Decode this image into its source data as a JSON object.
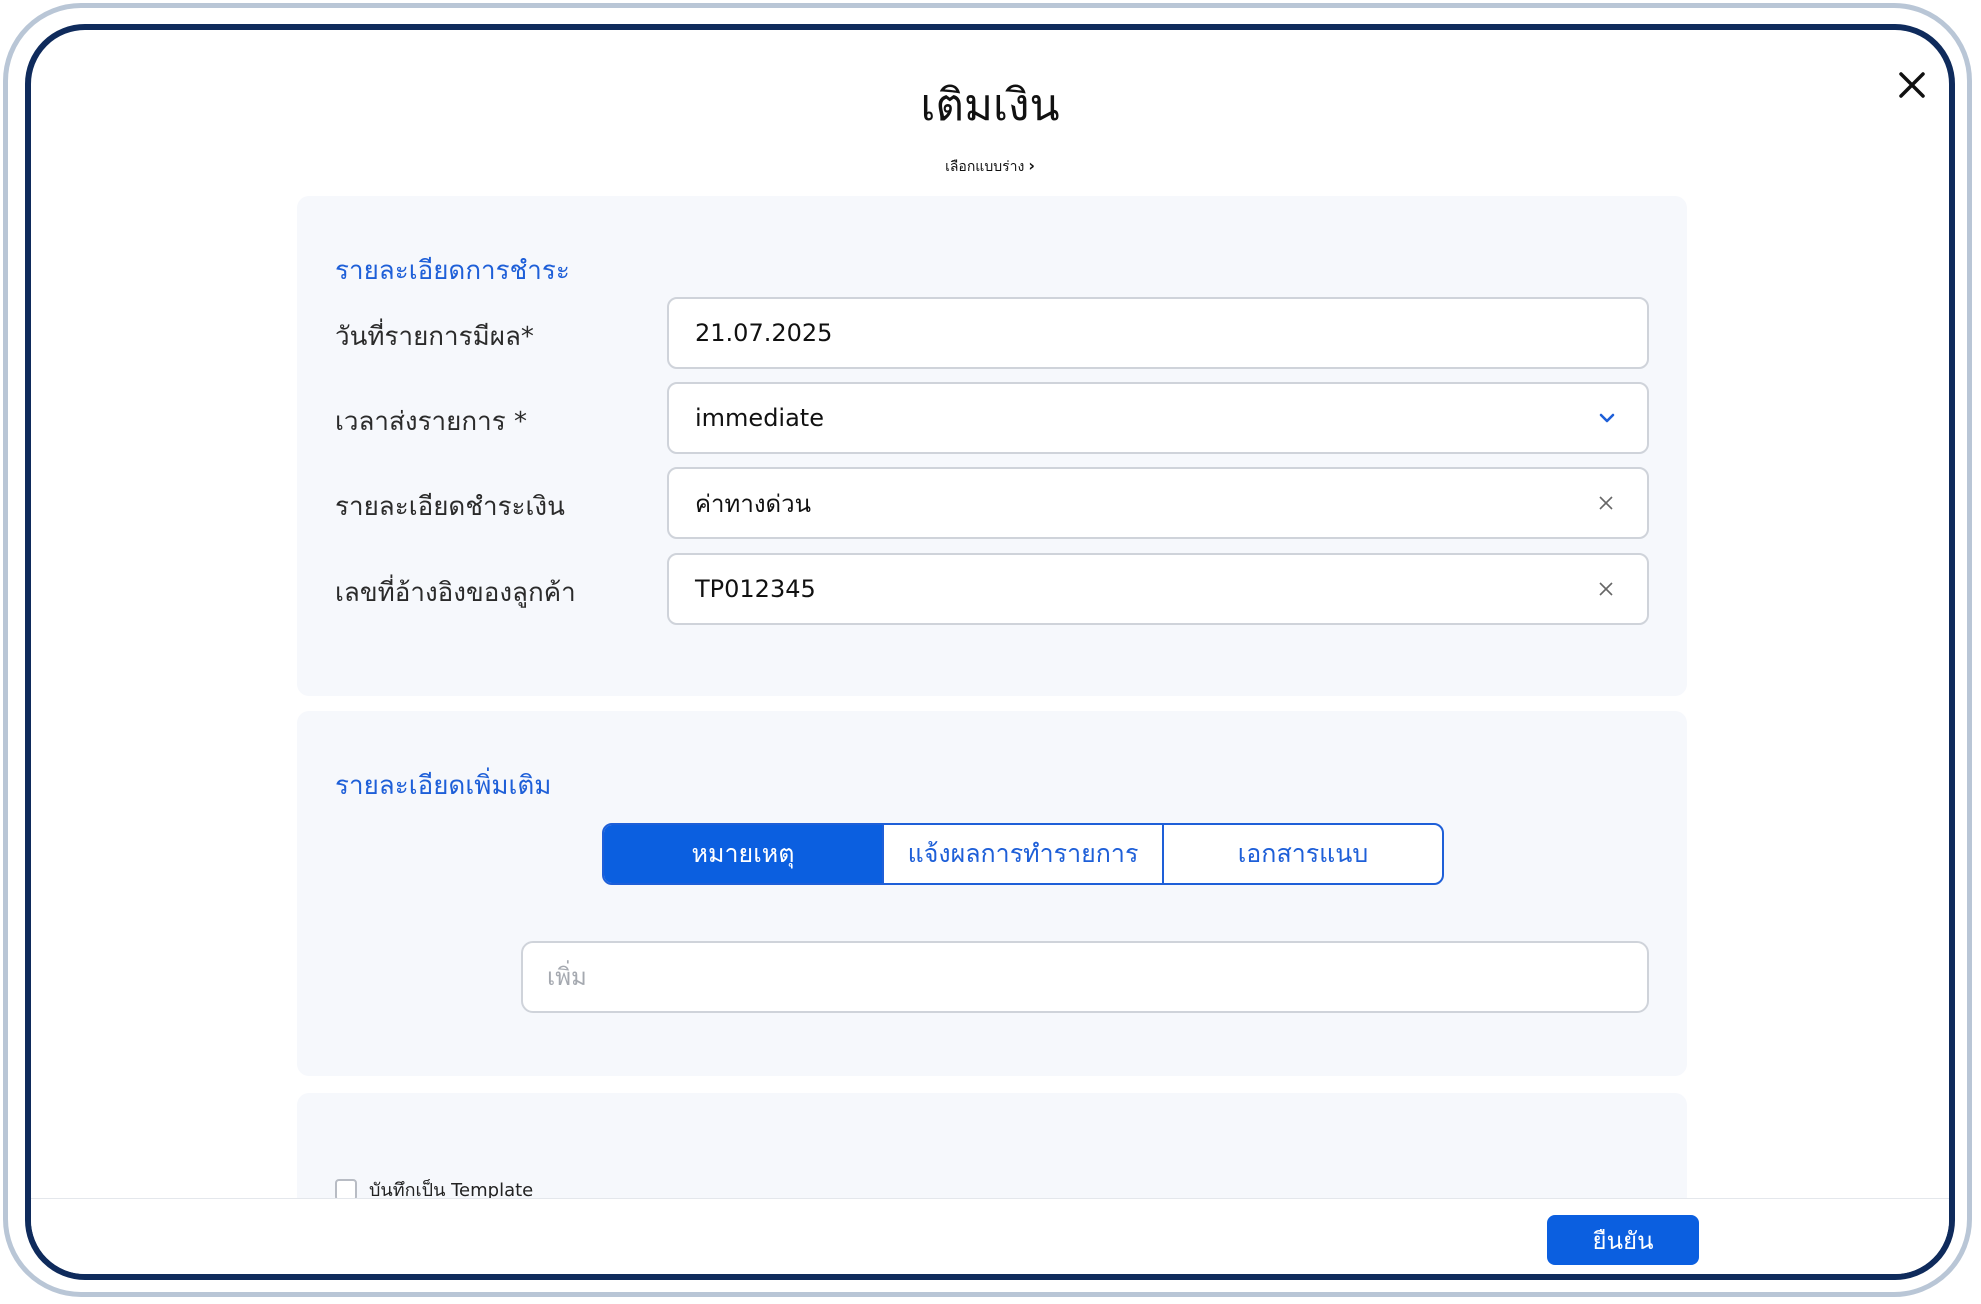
{
  "dialog": {
    "title": "เติมเงิน",
    "close_icon": "close-icon",
    "draft_link": "เลือกแบบร่าง",
    "draft_chevron_icon": "chevron-right-icon"
  },
  "payment_details": {
    "section_title": "รายละเอียดการชำระ",
    "effective_date": {
      "label": "วันที่รายการมีผล*",
      "value": "21.07.2025"
    },
    "send_time": {
      "label": "เวลาส่งรายการ *",
      "value": "immediate",
      "icon": "chevron-down-icon"
    },
    "payment_description": {
      "label": "รายละเอียดชำระเงิน",
      "value": "ค่าทางด่วน",
      "icon": "clear-icon"
    },
    "customer_reference": {
      "label": "เลขที่อ้างอิงของลูกค้า",
      "value": "TP012345",
      "icon": "clear-icon"
    }
  },
  "additional_details": {
    "section_title": "รายละเอียดเพิ่มเติม",
    "tabs": [
      {
        "label": "หมายเหตุ",
        "active": true
      },
      {
        "label": "แจ้งผลการทำรายการ",
        "active": false
      },
      {
        "label": "เอกสารแนบ",
        "active": false
      }
    ],
    "note_placeholder": "เพิ่ม"
  },
  "template": {
    "checkbox_label": "บันทึกเป็น Template",
    "checked": false
  },
  "footer": {
    "confirm_label": "ยืนยัน"
  },
  "colors": {
    "accent": "#0b5fe0",
    "section_title": "#1e5fd8",
    "card_background": "#f6f8fc",
    "frame_border": "#0f2b5c"
  }
}
